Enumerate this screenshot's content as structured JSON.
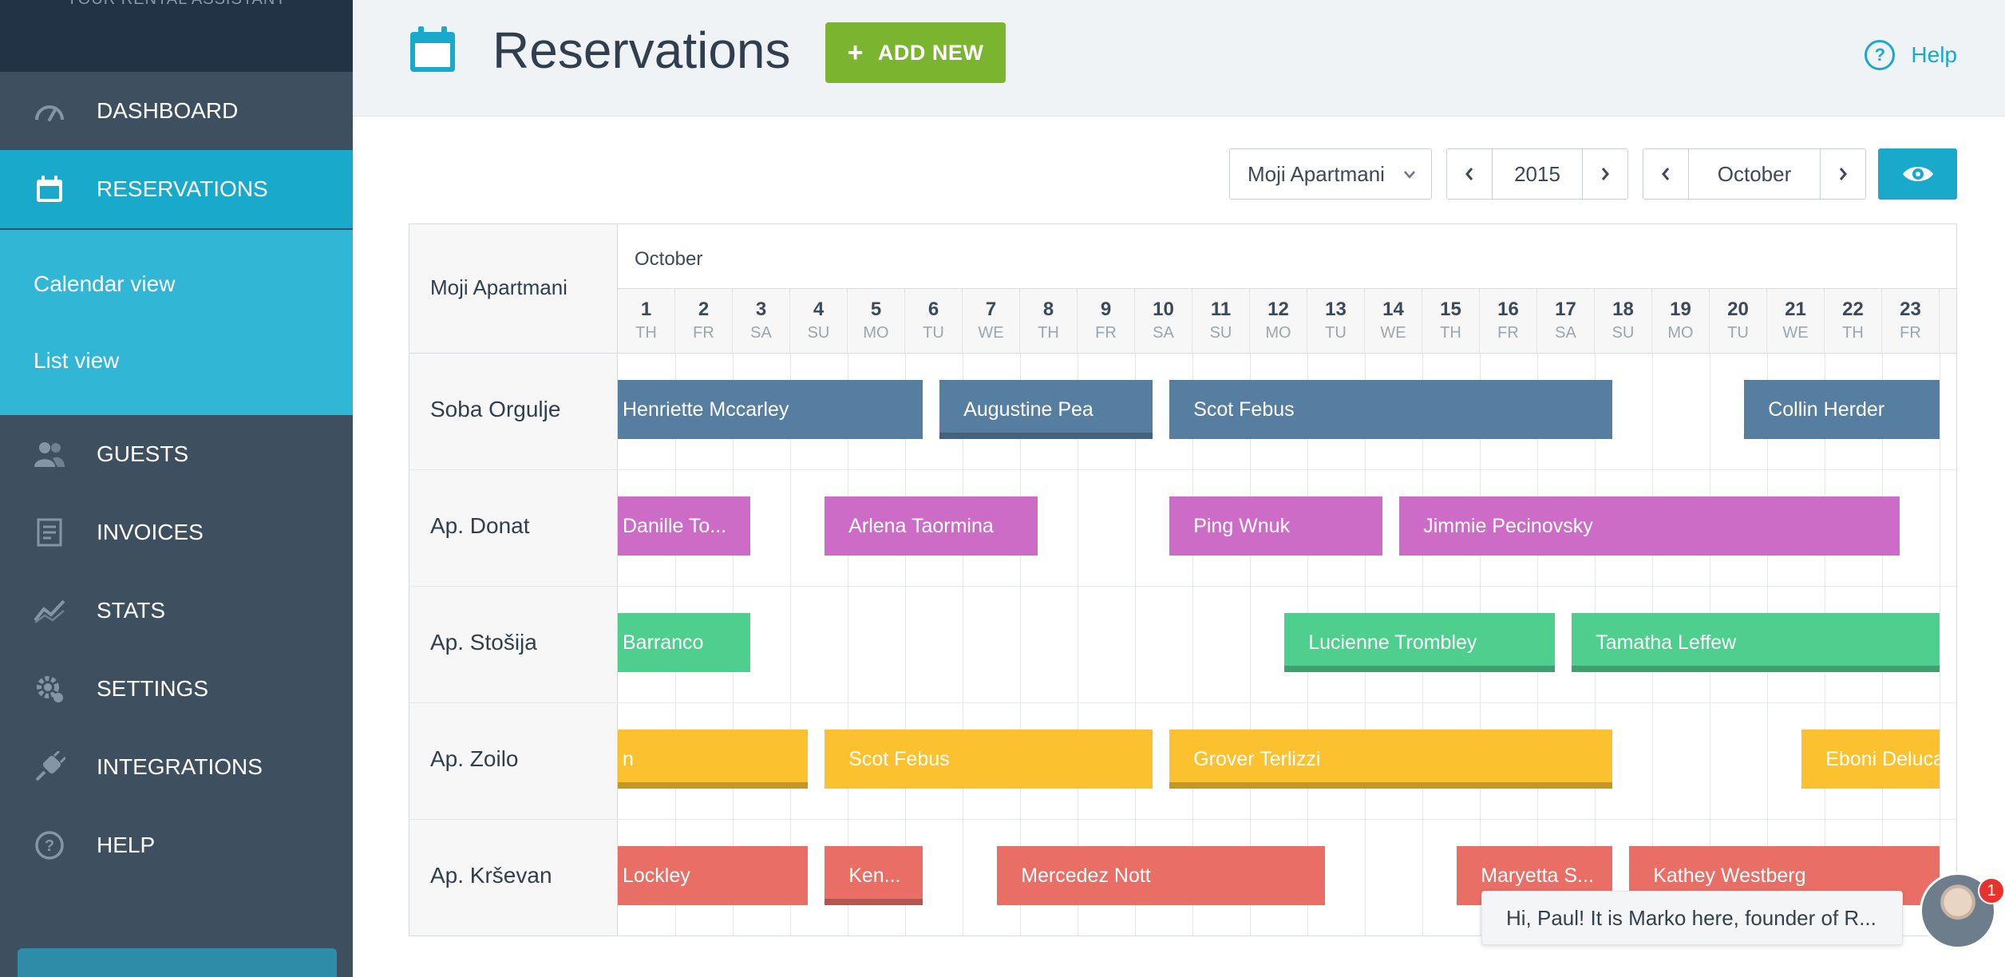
{
  "sidebar": {
    "tagline": "YOUR RENTAL ASSISTANT",
    "items": [
      {
        "label": "DASHBOARD",
        "icon": "gauge-icon"
      },
      {
        "label": "RESERVATIONS",
        "icon": "calendar-icon",
        "active": true
      },
      {
        "label": "GUESTS",
        "icon": "users-icon"
      },
      {
        "label": "INVOICES",
        "icon": "invoice-icon"
      },
      {
        "label": "STATS",
        "icon": "stats-icon"
      },
      {
        "label": "SETTINGS",
        "icon": "settings-icon"
      },
      {
        "label": "INTEGRATIONS",
        "icon": "plug-icon"
      },
      {
        "label": "HELP",
        "icon": "help-icon"
      }
    ],
    "subnav": [
      {
        "label": "Calendar view"
      },
      {
        "label": "List view"
      }
    ]
  },
  "header": {
    "title": "Reservations",
    "add_button": "ADD NEW",
    "help_label": "Help"
  },
  "controls": {
    "property": "Moji Apartmani",
    "year": "2015",
    "month": "October"
  },
  "calendar": {
    "property": "Moji Apartmani",
    "month": "October",
    "days": [
      {
        "num": "1",
        "dow": "TH"
      },
      {
        "num": "2",
        "dow": "FR"
      },
      {
        "num": "3",
        "dow": "SA"
      },
      {
        "num": "4",
        "dow": "SU"
      },
      {
        "num": "5",
        "dow": "MO"
      },
      {
        "num": "6",
        "dow": "TU"
      },
      {
        "num": "7",
        "dow": "WE"
      },
      {
        "num": "8",
        "dow": "TH"
      },
      {
        "num": "9",
        "dow": "FR"
      },
      {
        "num": "10",
        "dow": "SA"
      },
      {
        "num": "11",
        "dow": "SU"
      },
      {
        "num": "12",
        "dow": "MO"
      },
      {
        "num": "13",
        "dow": "TU"
      },
      {
        "num": "14",
        "dow": "WE"
      },
      {
        "num": "15",
        "dow": "TH"
      },
      {
        "num": "16",
        "dow": "FR"
      },
      {
        "num": "17",
        "dow": "SA"
      },
      {
        "num": "18",
        "dow": "SU"
      },
      {
        "num": "19",
        "dow": "MO"
      },
      {
        "num": "20",
        "dow": "TU"
      },
      {
        "num": "21",
        "dow": "WE"
      },
      {
        "num": "22",
        "dow": "TH"
      },
      {
        "num": "23",
        "dow": "FR"
      }
    ],
    "rooms": [
      {
        "name": "Soba Orgulje",
        "color": "#557ea0",
        "bookings": [
          {
            "guest": "Henriette Mccarley",
            "start": 1,
            "end": 6.3
          },
          {
            "guest": "Augustine Pea",
            "start": 6.6,
            "end": 10.3,
            "accent": true
          },
          {
            "guest": "Scot Febus",
            "start": 10.6,
            "end": 18.3
          },
          {
            "guest": "Collin Herder",
            "start": 20.6,
            "end": 24
          }
        ]
      },
      {
        "name": "Ap. Donat",
        "color": "#cc6cc7",
        "bookings": [
          {
            "guest": "Danille To...",
            "start": 1,
            "end": 3.3
          },
          {
            "guest": "Arlena Taormina",
            "start": 4.6,
            "end": 8.3
          },
          {
            "guest": "Ping Wnuk",
            "start": 10.6,
            "end": 14.3
          },
          {
            "guest": "Jimmie Pecinovsky",
            "start": 14.6,
            "end": 23.3
          }
        ]
      },
      {
        "name": "Ap. Stošija",
        "color": "#4ecf8e",
        "bookings": [
          {
            "guest": "Barranco",
            "start": 1,
            "end": 3.3
          },
          {
            "guest": "Lucienne Trombley",
            "start": 12.6,
            "end": 17.3,
            "accent": true
          },
          {
            "guest": "Tamatha Leffew",
            "start": 17.6,
            "end": 24,
            "accent": true
          }
        ]
      },
      {
        "name": "Ap. Zoilo",
        "color": "#fbc12f",
        "bookings": [
          {
            "guest": "n",
            "start": 1,
            "end": 4.3,
            "accent": true
          },
          {
            "guest": "Scot Febus",
            "start": 4.6,
            "end": 10.3
          },
          {
            "guest": "Grover Terlizzi",
            "start": 10.6,
            "end": 18.3,
            "accent": true
          },
          {
            "guest": "Eboni Deluca",
            "start": 21.6,
            "end": 24
          }
        ]
      },
      {
        "name": "Ap. Krševan",
        "color": "#e86e66",
        "bookings": [
          {
            "guest": "Lockley",
            "start": 1,
            "end": 4.3
          },
          {
            "guest": "Ken...",
            "start": 4.6,
            "end": 6.3,
            "accent": true
          },
          {
            "guest": "Mercedez Nott",
            "start": 7.6,
            "end": 13.3
          },
          {
            "guest": "Maryetta S...",
            "start": 15.6,
            "end": 18.3
          },
          {
            "guest": "Kathey Westberg",
            "start": 18.6,
            "end": 24
          }
        ]
      }
    ]
  },
  "chat": {
    "message": "Hi, Paul! It is Marko here, founder of R...",
    "badge": "1"
  },
  "colors": {
    "accent": "#19a9cb",
    "add_button": "#7bb530",
    "sidebar": "#3e5060"
  }
}
